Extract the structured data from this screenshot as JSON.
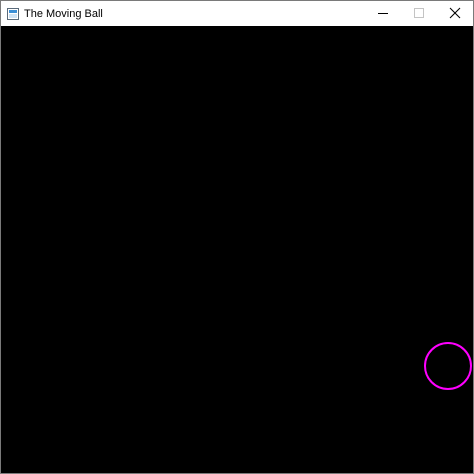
{
  "window": {
    "title": "The Moving Ball",
    "icon": "app-window-icon"
  },
  "caption_buttons": {
    "minimize_icon": "minimize-icon",
    "maximize_icon": "maximize-icon",
    "close_icon": "close-icon"
  },
  "canvas": {
    "background": "#000000",
    "ball": {
      "shape": "circle-outline",
      "color": "#ff00ff"
    }
  }
}
